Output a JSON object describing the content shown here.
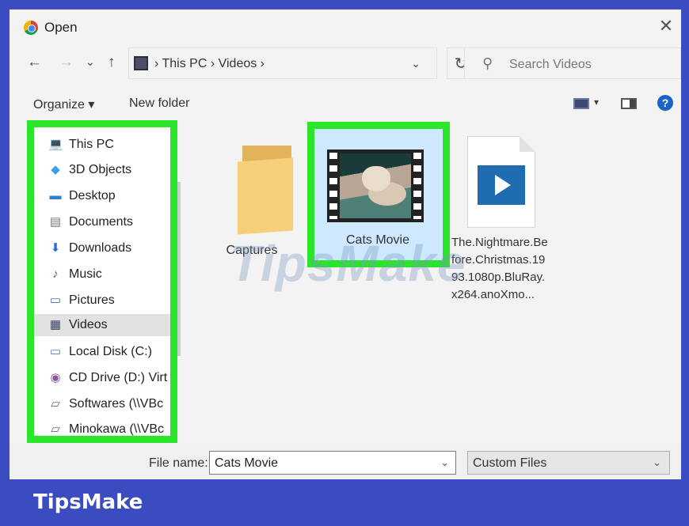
{
  "window": {
    "title": "Open",
    "close": "✕"
  },
  "nav": {
    "back": "←",
    "forward": "→",
    "recent": "⌄",
    "up": "↑",
    "address": "› This PC › Videos ›",
    "address_dropdown": "⌄",
    "refresh": "↻",
    "search_placeholder": "Search Videos"
  },
  "toolbar": {
    "organize": "Organize ▾",
    "new_folder": "New folder",
    "view_dropdown": "▾",
    "help": "?"
  },
  "sidebar": {
    "items": [
      {
        "label": "This PC",
        "icon": "💻"
      },
      {
        "label": "3D Objects",
        "icon": "◆"
      },
      {
        "label": "Desktop",
        "icon": "▬"
      },
      {
        "label": "Documents",
        "icon": "▤"
      },
      {
        "label": "Downloads",
        "icon": "⬇"
      },
      {
        "label": "Music",
        "icon": "♪"
      },
      {
        "label": "Pictures",
        "icon": "▭"
      },
      {
        "label": "Videos",
        "icon": "▦"
      },
      {
        "label": "Local Disk (C:)",
        "icon": "▭"
      },
      {
        "label": "CD Drive (D:) Virt",
        "icon": "◉"
      },
      {
        "label": "Softwares (\\\\VBc",
        "icon": "▱"
      },
      {
        "label": "Minokawa (\\\\VBc",
        "icon": "▱"
      }
    ],
    "selected": "Videos"
  },
  "files": {
    "captures": "Captures",
    "cats_movie": "Cats Movie",
    "nightmare": "The.Nightmare.Before.Christmas.1993.1080p.BluRay.x264.anoXmo..."
  },
  "watermark": "TipsMake",
  "bottom": {
    "filename_label": "File name:",
    "filename_value": "Cats Movie",
    "filename_drop": "⌄",
    "filetype": "Custom Files",
    "filetype_drop": "⌄"
  },
  "brand": "TipsMake",
  "colors": {
    "highlight": "#2be52b",
    "frame": "#3b4cc0",
    "selection": "#cde8ff"
  }
}
